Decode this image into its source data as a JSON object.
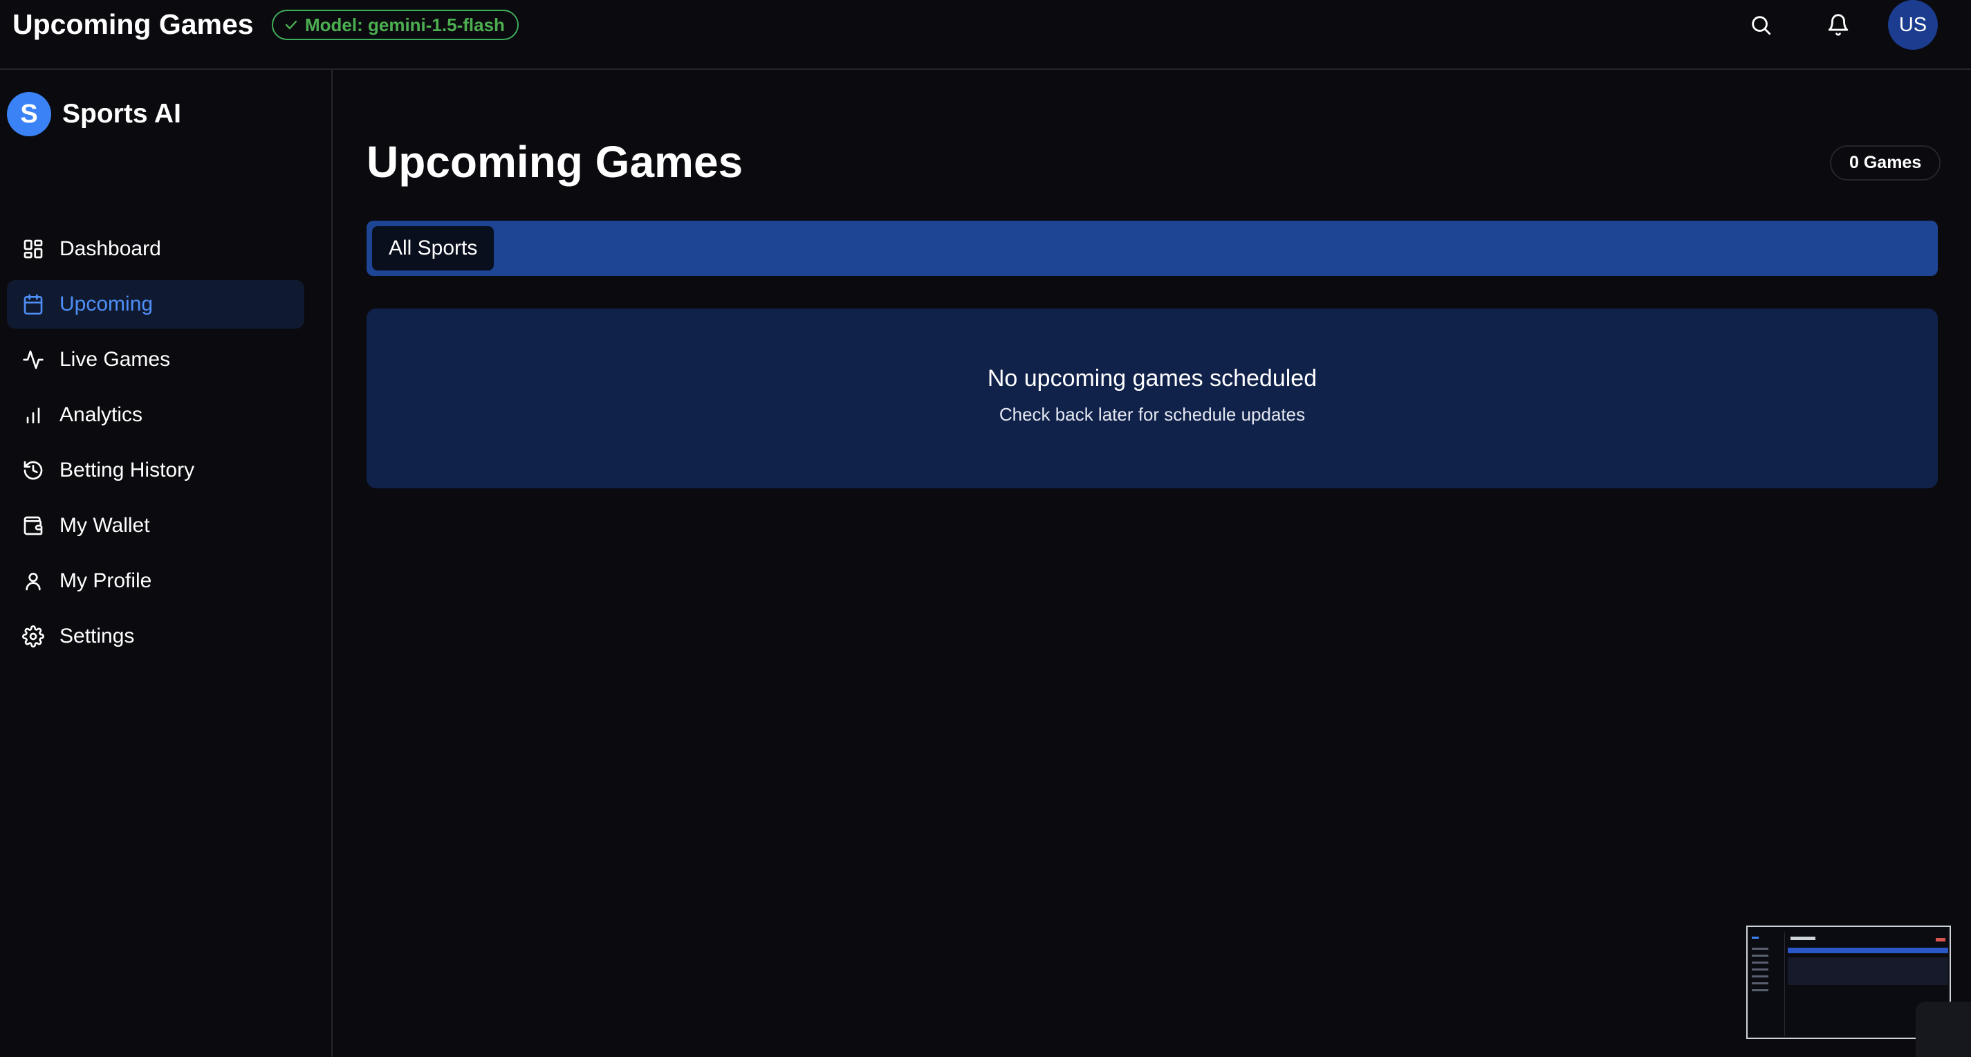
{
  "header": {
    "title": "Upcoming Games",
    "model_badge": "Model: gemini-1.5-flash",
    "avatar_initials": "US",
    "search_icon": "search-icon",
    "bell_icon": "bell-icon"
  },
  "sidebar": {
    "brand_initial": "S",
    "brand_name": "Sports AI",
    "items": [
      {
        "label": "Dashboard",
        "icon": "grid-icon",
        "active": false
      },
      {
        "label": "Upcoming",
        "icon": "calendar-icon",
        "active": true
      },
      {
        "label": "Live Games",
        "icon": "activity-icon",
        "active": false
      },
      {
        "label": "Analytics",
        "icon": "bar-chart-icon",
        "active": false
      },
      {
        "label": "Betting History",
        "icon": "history-icon",
        "active": false
      },
      {
        "label": "My Wallet",
        "icon": "wallet-icon",
        "active": false
      },
      {
        "label": "My Profile",
        "icon": "user-icon",
        "active": false
      },
      {
        "label": "Settings",
        "icon": "gear-icon",
        "active": false
      }
    ]
  },
  "main": {
    "page_title": "Upcoming Games",
    "games_count": "0 Games",
    "filter_tabs": [
      "All Sports"
    ],
    "empty_state": {
      "title": "No upcoming games scheduled",
      "subtitle": "Check back later for schedule updates"
    }
  },
  "colors": {
    "background": "#0a0a0f",
    "accent": "#3b82f6",
    "active_nav_text": "#4f8ef7",
    "filter_bar": "#1e4494",
    "empty_card": "#10214a",
    "badge_green": "#4caf50"
  }
}
